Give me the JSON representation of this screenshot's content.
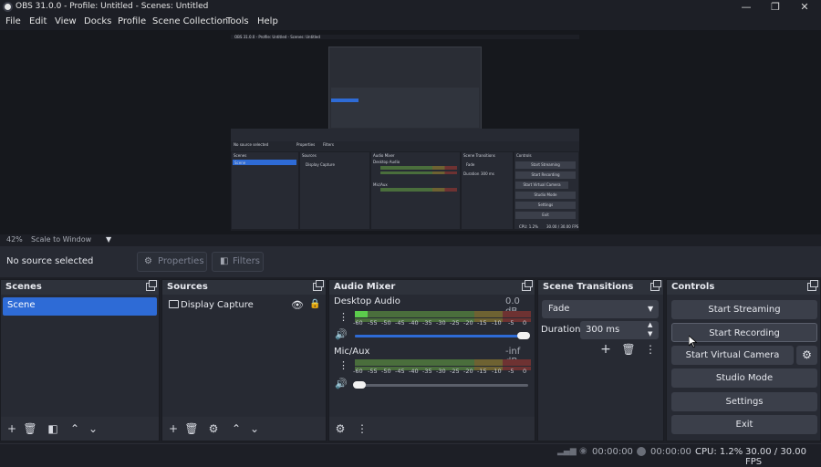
{
  "window": {
    "title": "OBS 31.0.0 - Profile: Untitled - Scenes: Untitled"
  },
  "menu": [
    "File",
    "Edit",
    "View",
    "Docks",
    "Profile",
    "Scene Collection",
    "Tools",
    "Help"
  ],
  "preview": {
    "zoom": "42%",
    "scale_mode": "Scale to Window"
  },
  "source_bar": {
    "no_source": "No source selected",
    "properties": "Properties",
    "filters": "Filters"
  },
  "scenes": {
    "title": "Scenes",
    "items": [
      "Scene"
    ]
  },
  "sources": {
    "title": "Sources",
    "items": [
      "Display Capture"
    ]
  },
  "mixer": {
    "title": "Audio Mixer",
    "channels": [
      {
        "name": "Desktop Audio",
        "level": "0.0 dB",
        "volume": 1.0
      },
      {
        "name": "Mic/Aux",
        "level": "-inf dB",
        "volume": 0.0
      }
    ],
    "ticks": [
      "-60",
      "-55",
      "-50",
      "-45",
      "-40",
      "-35",
      "-30",
      "-25",
      "-20",
      "-15",
      "-10",
      "-5",
      "0"
    ]
  },
  "transitions": {
    "title": "Scene Transitions",
    "selected": "Fade",
    "duration_label": "Duration",
    "duration_value": "300 ms"
  },
  "controls": {
    "title": "Controls",
    "buttons": [
      "Start Streaming",
      "Start Recording",
      "Start Virtual Camera",
      "Studio Mode",
      "Settings",
      "Exit"
    ]
  },
  "status": {
    "stream_time": "00:00:00",
    "record_time": "00:00:00",
    "cpu": "CPU: 1.2%",
    "fps": "30.00 / 30.00 FPS"
  },
  "nested": {
    "title": "OBS 31.0.0 - Profile: Untitled - Scenes: Untitled",
    "no_source": "No source selected",
    "properties": "Properties",
    "filters": "Filters",
    "scenes": "Scenes",
    "sources": "Sources",
    "mixer": "Audio Mixer",
    "transitions": "Scene Transitions",
    "controls": "Controls",
    "scene_item": "Scene",
    "source_item": "Display Capture",
    "desktop_audio": "Desktop Audio",
    "mic": "Mic/Aux",
    "fade": "Fade",
    "duration": "Duration",
    "duration_value": "300 ms",
    "btn1": "Start Streaming",
    "btn2": "Start Recording",
    "btn3": "Start Virtual Camera",
    "btn4": "Studio Mode",
    "btn5": "Settings",
    "btn6": "Exit",
    "status": "CPU: 1.2%",
    "fps": "30.00 / 30.00 FPS"
  },
  "colors": {
    "accent": "#2e6bd6",
    "panel": "#272a33",
    "button": "#3b3f4a"
  }
}
